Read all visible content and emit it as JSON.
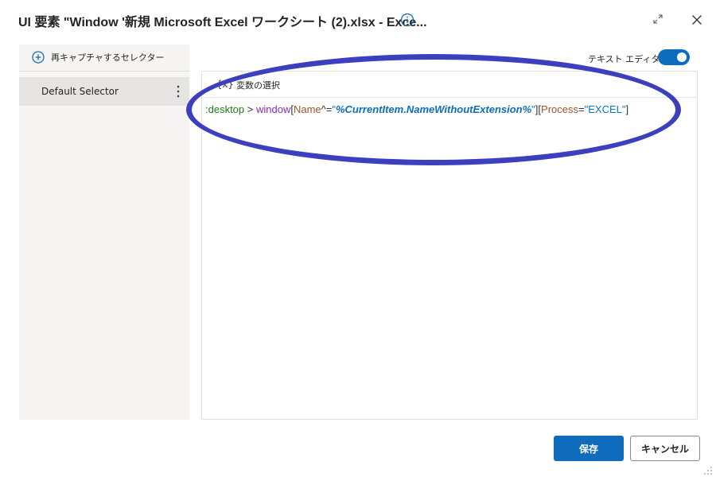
{
  "dialog": {
    "title": "UI 要素 \"Window '新規 Microsoft Excel ワークシート (2).xlsx - Exce..."
  },
  "sidebar": {
    "recapture_label": "再キャプチャするセレクター",
    "selectors": [
      {
        "label": "Default Selector"
      }
    ]
  },
  "toggle": {
    "label": "テキスト エディター",
    "enabled": true
  },
  "editor": {
    "variable_icon": "{x}",
    "variable_label": "変数の選択",
    "code": {
      "p1": ":desktop",
      "p2": " > ",
      "p3": "window",
      "p4": "[",
      "p5": "Name",
      "p6": "^=",
      "p7": "\"",
      "p8": "%CurrentItem.NameWithoutExtension%",
      "p9": "\"",
      "p10": "]",
      "p11": "[",
      "p12": "Process",
      "p13": "=",
      "p14": "\"EXCEL\"",
      "p15": "]"
    }
  },
  "buttons": {
    "save": "保存",
    "cancel": "キャンセル"
  },
  "colors": {
    "accent": "#0f6cbd",
    "annotation_oval": "#3c3fbe"
  }
}
